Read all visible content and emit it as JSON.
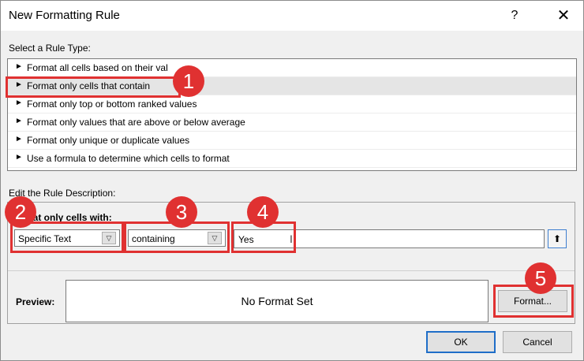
{
  "dialog": {
    "title": "New Formatting Rule",
    "help_label": "?",
    "close_label": "✕"
  },
  "rule_type": {
    "heading": "Select a Rule Type:",
    "arrow": "►",
    "items": [
      {
        "label": "Format all cells based on their val"
      },
      {
        "label": "Format only cells that contain"
      },
      {
        "label": "Format only top or bottom ranked values"
      },
      {
        "label": "Format only values that are above or below average"
      },
      {
        "label": "Format only unique or duplicate values"
      },
      {
        "label": "Use a formula to determine which cells to format"
      }
    ],
    "selected_index": 1
  },
  "description": {
    "heading": "Edit the Rule Description:",
    "format_label": "mat only cells with:",
    "condition_type": "Specific Text",
    "operator": "containing",
    "value": "Yes",
    "dropdown_glyph": "▽",
    "collapse_glyph": "⬆"
  },
  "preview": {
    "label": "Preview:",
    "text": "No Format Set",
    "format_button": "Format..."
  },
  "buttons": {
    "ok": "OK",
    "cancel": "Cancel"
  },
  "callouts": [
    "1",
    "2",
    "3",
    "4",
    "5"
  ],
  "colors": {
    "callout": "#e03131",
    "ok_border": "#1f6ec8"
  }
}
